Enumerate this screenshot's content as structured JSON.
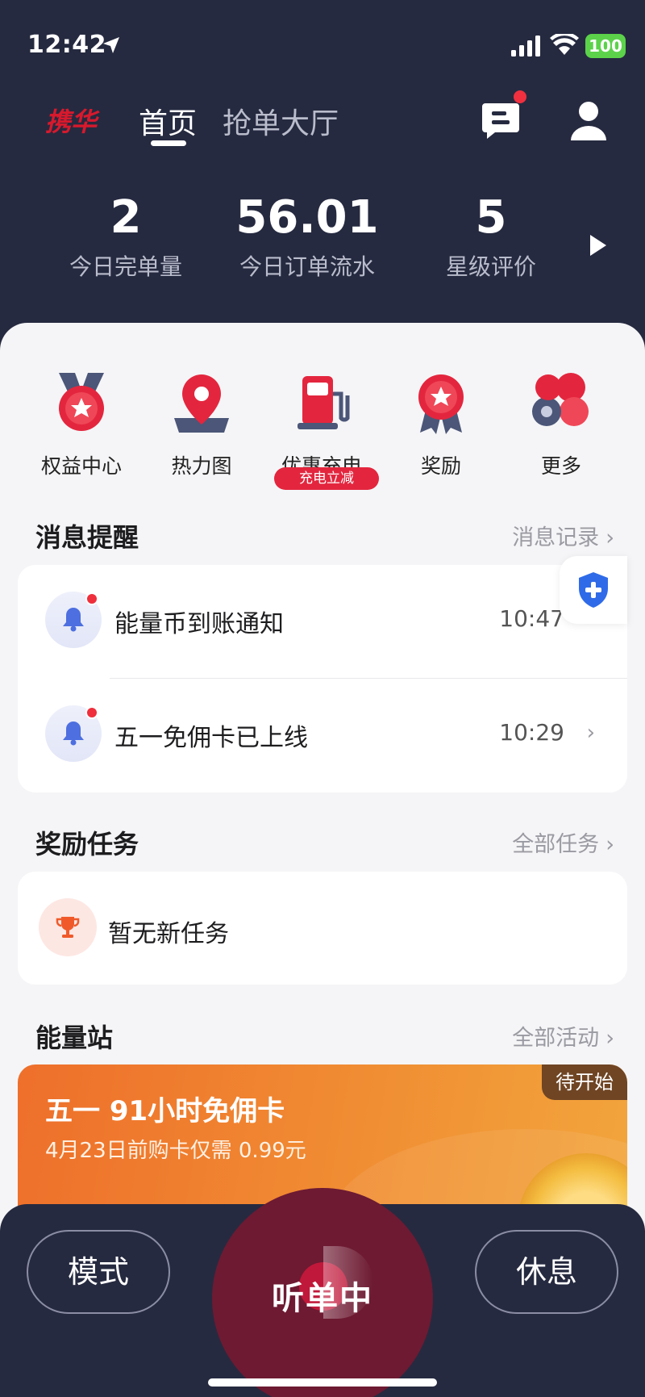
{
  "status": {
    "time": "12:42",
    "battery": "100"
  },
  "header": {
    "logo": "携华",
    "tab_home": "首页",
    "tab_hall": "抢单大厅"
  },
  "stats": [
    {
      "value": "2",
      "label": "今日完单量"
    },
    {
      "value": "56.01",
      "label": "今日订单流水"
    },
    {
      "value": "5",
      "label": "星级评价"
    }
  ],
  "services": [
    {
      "label": "权益中心",
      "icon": "rights-medal-icon"
    },
    {
      "label": "热力图",
      "icon": "heatmap-pin-icon"
    },
    {
      "label": "优惠充电",
      "icon": "charging-station-icon",
      "badge": "充电立减"
    },
    {
      "label": "奖励",
      "icon": "reward-badge-icon"
    },
    {
      "label": "更多",
      "icon": "more-icon"
    }
  ],
  "messages": {
    "title": "消息提醒",
    "link": "消息记录",
    "items": [
      {
        "text": "能量币到账通知",
        "time": "10:47"
      },
      {
        "text": "五一免佣卡已上线",
        "time": "10:29"
      }
    ]
  },
  "tasks": {
    "title": "奖励任务",
    "link": "全部任务",
    "empty_text": "暂无新任务"
  },
  "energy": {
    "title": "能量站",
    "link": "全部活动",
    "card_title": "五一 91小时免佣卡",
    "card_subtitle": "4月23日前购卡仅需 0.99元",
    "card_badge": "待开始"
  },
  "bottom": {
    "mode": "模式",
    "listening": "听单中",
    "rest": "休息"
  },
  "colors": {
    "dark_bg": "#262a40",
    "accent_red": "#e3263e",
    "orange_card": "#f08a32"
  }
}
